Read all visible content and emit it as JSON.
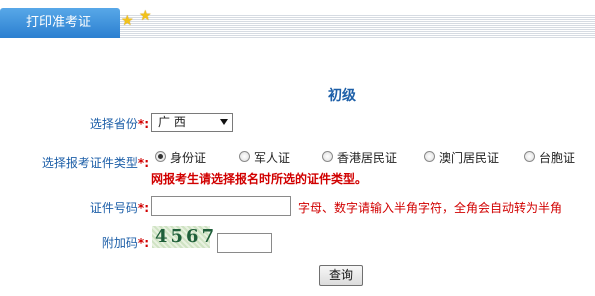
{
  "header": {
    "tab_label": "打印准考证"
  },
  "level_title": "初级",
  "province": {
    "label": "选择省份",
    "required_mark": "*:",
    "selected": "广 西"
  },
  "id_type": {
    "label": "选择报考证件类型",
    "required_mark": "*:",
    "options": [
      "身份证",
      "军人证",
      "香港居民证",
      "澳门居民证",
      "台胞证"
    ],
    "selected_index": 0
  },
  "warning_text": "网报考生请选择报名时所选的证件类型。",
  "id_number": {
    "label": "证件号码",
    "required_mark": "*:",
    "value": "",
    "hint": "字母、数字请输入半角字符，全角会自动转为半角"
  },
  "extra_code": {
    "label": "附加码",
    "required_mark": "*:",
    "captcha_text": "4567",
    "value": ""
  },
  "submit_label": "查询",
  "accent_color": "#1d5fa8",
  "warning_color": "#d10000"
}
